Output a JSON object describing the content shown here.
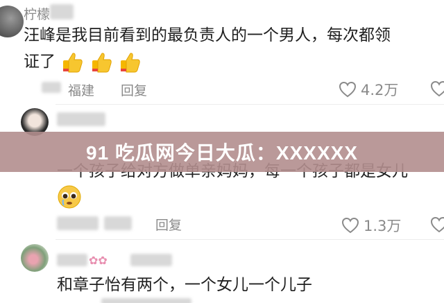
{
  "comments": [
    {
      "username": "柠檬",
      "line1": "汪峰是我目前看到的最负责人的一个男人，每次都领",
      "line2": "证了",
      "location": "福建",
      "reply_label": "回复",
      "likes": "4.2万",
      "emoji": "thumbs-up"
    },
    {
      "line1": "一个孩子给对方做单亲妈妈，每一个孩子都是女儿",
      "reply_label": "回复",
      "likes": "1.3万",
      "emoji": "pleading-face"
    },
    {
      "line1": "和章子怡有两个，一个女儿一个儿子"
    }
  ],
  "banner": {
    "title": "91 吃瓜网今日大瓜：XXXXXX"
  },
  "colors": {
    "banner": "#b28e8e",
    "meta": "#8a8a8a",
    "text": "#1f1f1f"
  }
}
